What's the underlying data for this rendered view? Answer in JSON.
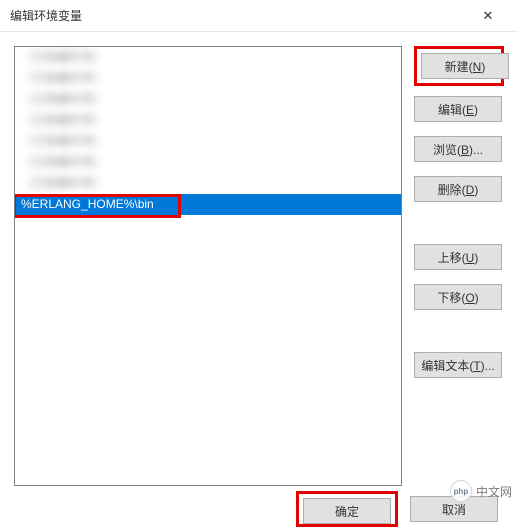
{
  "titlebar": {
    "title": "编辑环境变量",
    "close": "✕"
  },
  "list": {
    "items": [
      "（已隐藏的项）",
      "（已隐藏的项）",
      "（已隐藏的项）",
      "（已隐藏的项）",
      "（已隐藏的项）",
      "（已隐藏的项）",
      "（已隐藏的项）",
      "%ERLANG_HOME%\\bin"
    ],
    "selected_index": 7
  },
  "buttons": {
    "new": "新建",
    "new_key": "N",
    "edit": "编辑",
    "edit_key": "E",
    "browse": "浏览",
    "browse_key": "B",
    "browse_suffix": "...",
    "delete": "删除",
    "delete_key": "D",
    "moveup": "上移",
    "moveup_key": "U",
    "movedown": "下移",
    "movedown_key": "O",
    "edittext": "编辑文本",
    "edittext_key": "T",
    "edittext_suffix": "...",
    "ok": "确定",
    "cancel": "取消"
  },
  "watermark": {
    "logo": "php",
    "text": "中文网"
  }
}
